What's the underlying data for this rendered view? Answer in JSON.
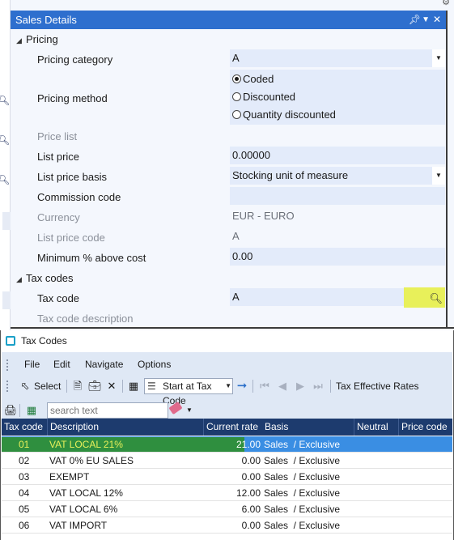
{
  "sales_details": {
    "title": "Sales Details",
    "pricing_section": "Pricing",
    "fields": {
      "pricing_category": {
        "label": "Pricing category",
        "value": "A"
      },
      "pricing_method": {
        "label": "Pricing method",
        "options": [
          "Coded",
          "Discounted",
          "Quantity discounted"
        ],
        "selected": "Coded"
      },
      "price_list": {
        "label": "Price list",
        "value": ""
      },
      "list_price": {
        "label": "List price",
        "value": "0.00000"
      },
      "list_price_basis": {
        "label": "List price basis",
        "value": "Stocking unit of measure"
      },
      "commission_code": {
        "label": "Commission code",
        "value": ""
      },
      "currency": {
        "label": "Currency",
        "value": "EUR - EURO"
      },
      "list_price_code": {
        "label": "List price code",
        "value": "A"
      },
      "min_above_cost": {
        "label": "Minimum % above cost",
        "value": "0.00"
      }
    },
    "tax_section": "Tax codes",
    "tax_code": {
      "label": "Tax code",
      "value": "A"
    },
    "tax_code_description": {
      "label": "Tax code description"
    }
  },
  "tax_codes_window": {
    "title": "Tax Codes",
    "menu": [
      "File",
      "Edit",
      "Navigate",
      "Options"
    ],
    "toolbar": {
      "select_label": "Select",
      "start_at_label": "Start at Tax Code",
      "tax_effective_rates_label": "Tax Effective Rates"
    },
    "search": {
      "placeholder": "search text"
    },
    "columns": [
      "Tax code",
      "Description",
      "Current rate",
      "Basis",
      "Neutral",
      "Price code"
    ],
    "rows": [
      {
        "code": "01",
        "description": "VAT LOCAL 21%",
        "rate": "21.00",
        "basis": "Sales  / Exclusive",
        "selected": true
      },
      {
        "code": "02",
        "description": "VAT 0% EU SALES",
        "rate": "0.00",
        "basis": "Sales  / Exclusive"
      },
      {
        "code": "03",
        "description": "EXEMPT",
        "rate": "0.00",
        "basis": "Sales  / Exclusive"
      },
      {
        "code": "04",
        "description": "VAT LOCAL 12%",
        "rate": "12.00",
        "basis": "Sales  / Exclusive"
      },
      {
        "code": "05",
        "description": "VAT LOCAL 6%",
        "rate": "6.00",
        "basis": "Sales  / Exclusive"
      },
      {
        "code": "06",
        "description": "VAT IMPORT",
        "rate": "0.00",
        "basis": "Sales  / Exclusive"
      }
    ]
  },
  "colors": {
    "title_bar": "#2e6fce",
    "field_bg": "#e3ebfa",
    "grid_header": "#1d3b6e",
    "selected_row": "#3a8ee3",
    "highlight_yellow": "#e8f05a"
  }
}
